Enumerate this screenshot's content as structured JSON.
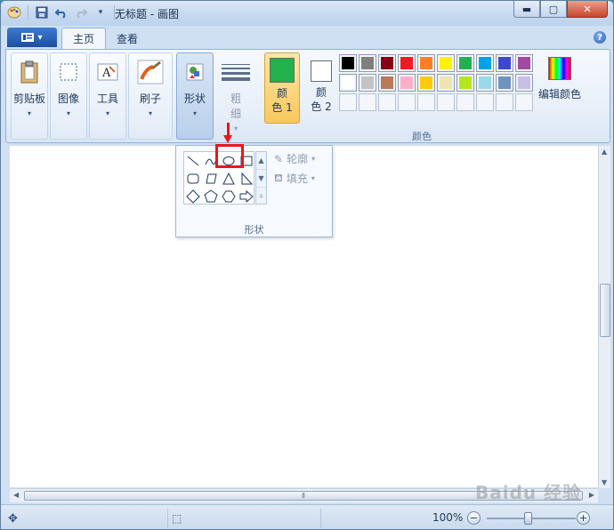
{
  "window": {
    "title": "无标题 - 画图"
  },
  "tabs": [
    {
      "label": "主页",
      "active": true
    },
    {
      "label": "查看",
      "active": false
    }
  ],
  "ribbon": {
    "clipboard_label": "剪贴板",
    "image_label": "图像",
    "tools_label": "工具",
    "brushes_label": "刷子",
    "shapes_label": "形状",
    "size_label": "粗",
    "size_label2": "细",
    "color1_label": "颜",
    "color1_label2": "色 1",
    "color2_label": "颜",
    "color2_label2": "色 2",
    "edit_colors_label": "编辑颜色",
    "colors_group_label": "颜色",
    "color1_value": "#22b14c",
    "color2_value": "#ffffff"
  },
  "palette": [
    "#000000",
    "#7f7f7f",
    "#880015",
    "#ed1c24",
    "#ff7f27",
    "#fff200",
    "#22b14c",
    "#00a2e8",
    "#3f48cc",
    "#a349a4",
    "#ffffff",
    "#c3c3c3",
    "#b97a57",
    "#ffaec9",
    "#ffc90e",
    "#efe4b0",
    "#b5e61d",
    "#99d9ea",
    "#7092be",
    "#c8bfe7",
    "",
    "",
    "",
    "",
    "",
    "",
    "",
    "",
    "",
    ""
  ],
  "shapes_popup": {
    "outline_label": "轮廓",
    "fill_label": "填充",
    "group_label": "形状",
    "shapes": [
      "line-icon",
      "curve-icon",
      "oval-icon",
      "rectangle-icon",
      "rounded-rectangle-icon",
      "polygon-icon",
      "triangle-icon",
      "right-triangle-icon",
      "diamond-icon",
      "pentagon-icon",
      "hexagon-icon",
      "right-arrow-icon"
    ]
  },
  "status": {
    "zoom": "100%"
  },
  "watermark": "Baidu 经验"
}
